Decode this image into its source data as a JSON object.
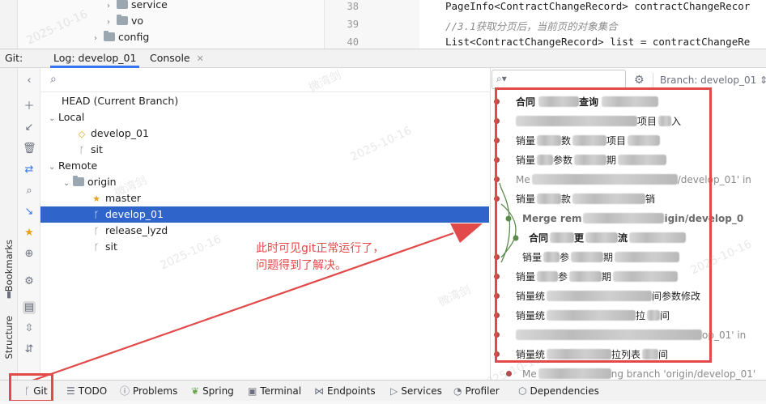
{
  "project_tree": [
    {
      "label": "service",
      "indent": 2
    },
    {
      "label": "vo",
      "indent": 2
    },
    {
      "label": "config",
      "indent": 1
    }
  ],
  "editor": {
    "line_numbers": [
      "38",
      "39",
      "40"
    ],
    "lines": [
      "PageInfo<ContractChangeRecord> contractChangeRecor",
      "//3.1获取分页后，当前页的对象集合",
      "List<ContractChangeRecord> list = contractChangeRe"
    ]
  },
  "git_window": {
    "title": "Git:",
    "tabs": [
      {
        "label": "Log: develop_01",
        "active": true
      },
      {
        "label": "Console",
        "active": false
      }
    ]
  },
  "side_labels": {
    "bookmarks": "Bookmarks",
    "structure": "Structure"
  },
  "branches": {
    "head": "HEAD (Current Branch)",
    "local_label": "Local",
    "local": [
      "develop_01",
      "sit"
    ],
    "remote_label": "Remote",
    "origin_label": "origin",
    "remote": [
      "master",
      "develop_01",
      "release_lyzd",
      "sit"
    ],
    "selected": "develop_01"
  },
  "log": {
    "branch_filter": "Branch: develop_01",
    "commits": [
      {
        "text": "合同",
        "suffix": "查询"
      },
      {
        "text": "",
        "suffix": "项目",
        "tail": "入"
      },
      {
        "text": "销量",
        "suffix": "数",
        "tail": "项目"
      },
      {
        "text": "销量",
        "suffix": "参数",
        "tail": "期"
      },
      {
        "text": "Me",
        "suffix": "/develop_01' in"
      },
      {
        "text": "销量",
        "suffix": "款",
        "tail": "销"
      },
      {
        "text": "Merge rem",
        "suffix": "igin/develop_0"
      },
      {
        "text": "合同",
        "suffix": "更",
        "tail": "流"
      },
      {
        "text": "销量",
        "suffix": "参",
        "tail": "期"
      },
      {
        "text": "销量",
        "suffix": "参",
        "tail": "期"
      },
      {
        "text": "销量统",
        "suffix": "间参数修改"
      },
      {
        "text": "销量统",
        "suffix": "拉",
        "tail": "间"
      },
      {
        "text": "",
        "suffix": "op_01' in"
      },
      {
        "text": "销量统",
        "suffix": "拉列表",
        "tail": "间"
      },
      {
        "text": "Me",
        "suffix": "ng branch 'origin/develop_01'"
      }
    ]
  },
  "annotation": [
    "此时可见git正常运行了，",
    "问题得到了解决。"
  ],
  "watermark_date": "2025-10-16",
  "watermark_name": "微湾剑",
  "bottom_tools": [
    "Git",
    "TODO",
    "Problems",
    "Spring",
    "Terminal",
    "Endpoints",
    "Services",
    "Profiler",
    "Dependencies"
  ],
  "colors": {
    "accent": "#3574f0",
    "selected": "#2f65ca",
    "annotation": "#e24a4a",
    "head_dot": "#b24a4a",
    "graph": "#5a8a4a"
  }
}
